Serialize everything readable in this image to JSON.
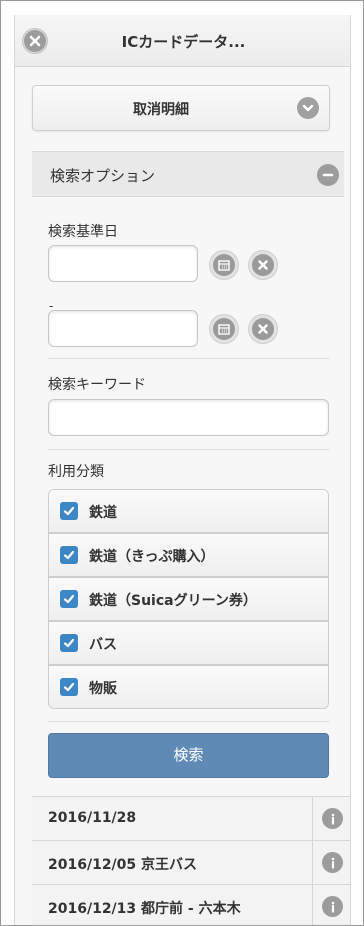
{
  "header": {
    "title": "ICカードデータ..."
  },
  "cancel_detail": {
    "label": "取消明細"
  },
  "search_options": {
    "label": "検索オプション",
    "date_label": "検索基準日",
    "date_separator": "-",
    "date_from": {
      "value": "",
      "placeholder": ""
    },
    "date_to": {
      "value": "",
      "placeholder": ""
    },
    "keyword_label": "検索キーワード",
    "keyword": {
      "value": "",
      "placeholder": ""
    },
    "category_label": "利用分類",
    "categories": [
      {
        "label": "鉄道",
        "checked": true
      },
      {
        "label": "鉄道（きっぷ購入）",
        "checked": true
      },
      {
        "label": "鉄道（Suicaグリーン券）",
        "checked": true
      },
      {
        "label": "バス",
        "checked": true
      },
      {
        "label": "物販",
        "checked": true
      }
    ],
    "search_button": "検索"
  },
  "results": [
    {
      "text": "2016/11/28"
    },
    {
      "text": "2016/12/05 京王バス"
    },
    {
      "text": "2016/12/13 都庁前 - 六本木"
    }
  ],
  "colors": {
    "checkbox": "#3d86c6",
    "search_button": "#5f8ab5"
  }
}
